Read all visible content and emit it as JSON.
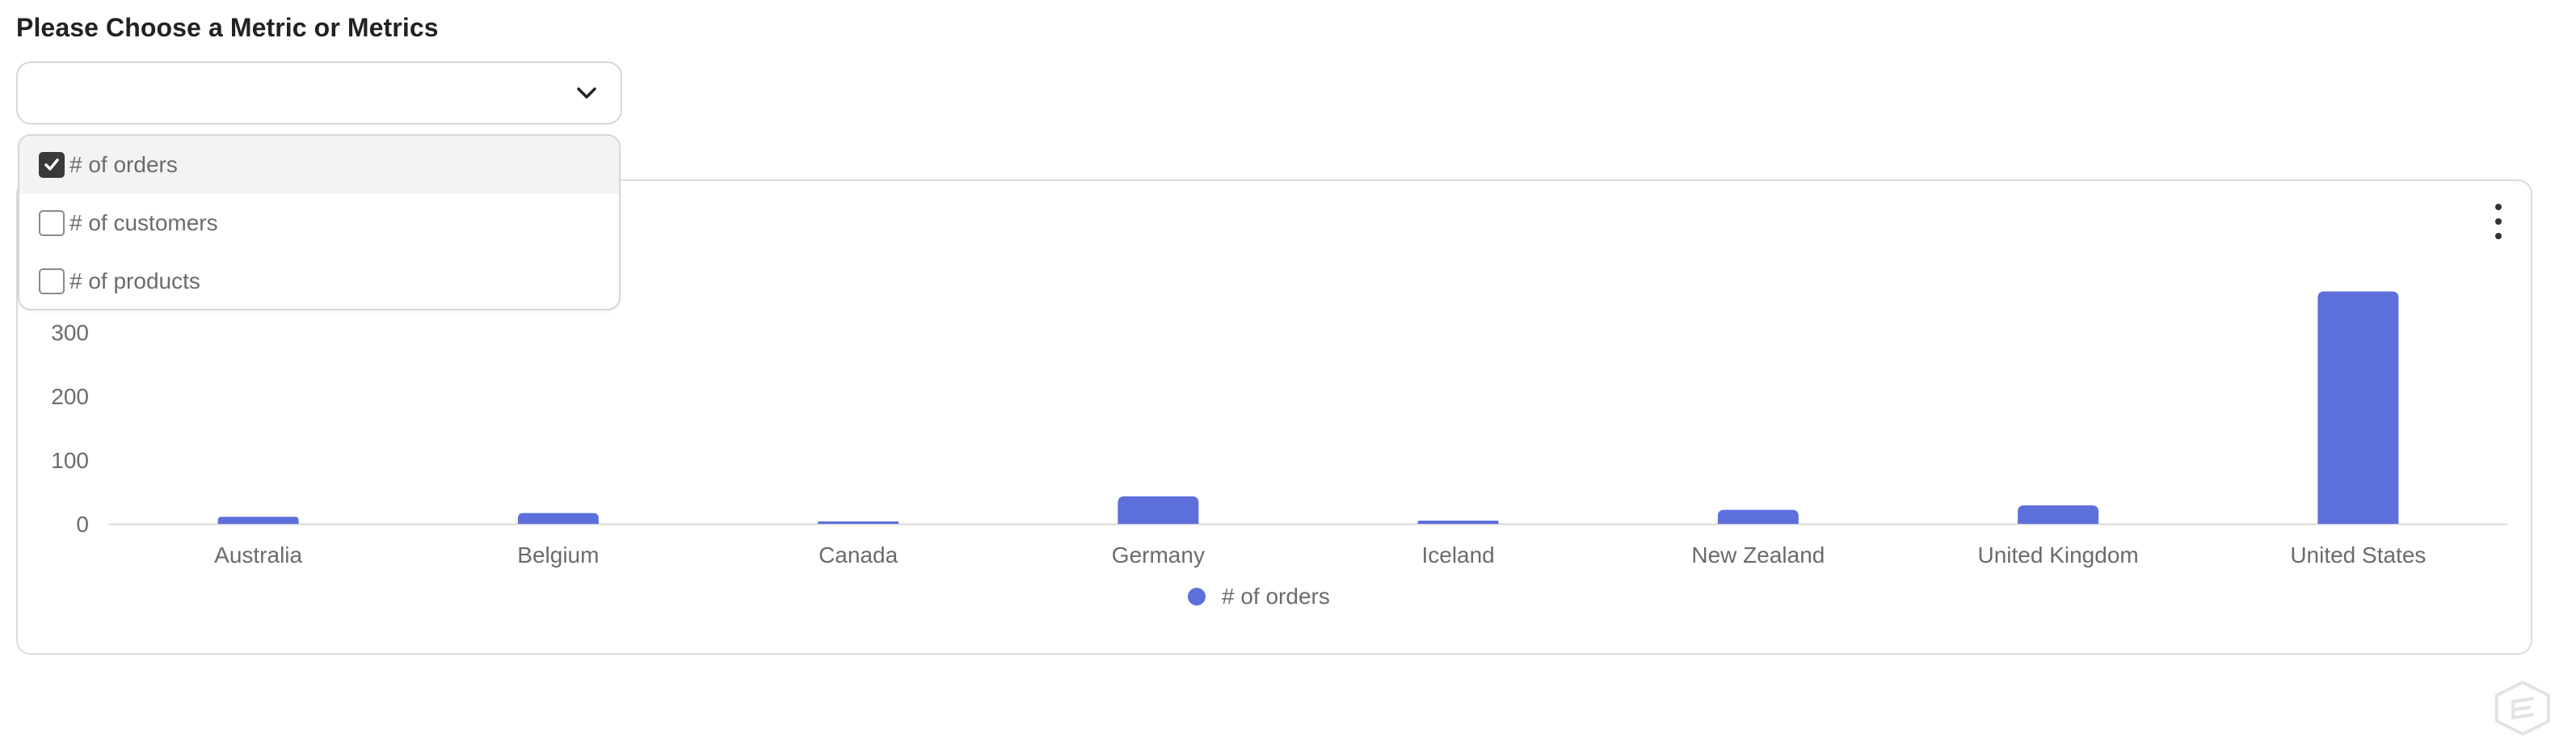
{
  "page": {
    "title": "Please Choose a Metric or Metrics"
  },
  "select": {
    "value": "",
    "options": [
      {
        "label": "# of orders",
        "checked": true
      },
      {
        "label": "# of customers",
        "checked": false
      },
      {
        "label": "# of products",
        "checked": false
      }
    ]
  },
  "chart_data": {
    "type": "bar",
    "categories": [
      "Australia",
      "Belgium",
      "Canada",
      "Germany",
      "Iceland",
      "New Zealand",
      "United Kingdom",
      "United States"
    ],
    "series": [
      {
        "name": "# of orders",
        "values": [
          11,
          17,
          3,
          43,
          5,
          22,
          29,
          364
        ],
        "color": "#5d6fdb"
      }
    ],
    "yticks": [
      0,
      100,
      200,
      300
    ],
    "ylim": [
      0,
      400
    ],
    "legend": "bottom-center",
    "grid": false
  },
  "colors": {
    "bar": "#5d6fdb",
    "checkbox_checked": "#3a3a3a"
  },
  "icons": {
    "select_chevron": "chevron-down-icon",
    "chart_menu": "kebab-icon",
    "brand": "brand-logo-icon"
  }
}
